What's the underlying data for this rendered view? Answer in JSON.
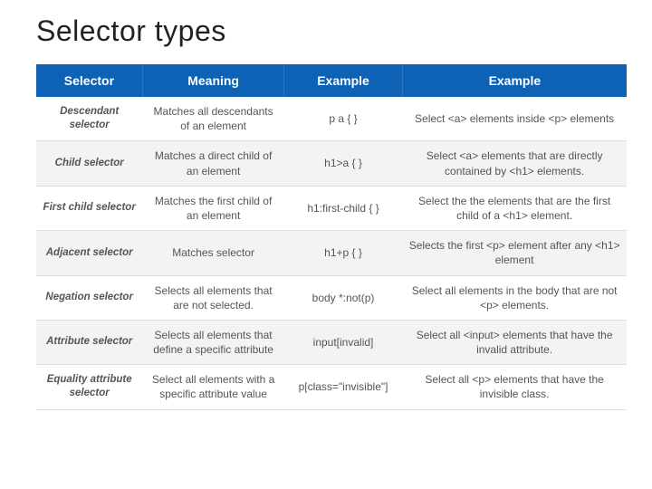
{
  "title": "Selector types",
  "table": {
    "headers": {
      "c0": "Selector",
      "c1": "Meaning",
      "c2": "Example",
      "c3": "Example"
    },
    "rows": [
      {
        "name": "Descendant selector",
        "meaning": "Matches all descendants of an element",
        "code": "p a { }",
        "description": "Select <a> elements inside <p> elements"
      },
      {
        "name": "Child selector",
        "meaning": "Matches a direct child of an element",
        "code": "h1>a { }",
        "description": "Select <a> elements that are directly contained by <h1> elements."
      },
      {
        "name": "First child selector",
        "meaning": "Matches the first child of an element",
        "code": "h1:first-child { }",
        "description": "Select the the elements that are the first child of a <h1> element."
      },
      {
        "name": "Adjacent selector",
        "meaning": "Matches selector",
        "code": "h1+p { }",
        "description": "Selects the first <p> element after any <h1> element"
      },
      {
        "name": "Negation selector",
        "meaning": "Selects all elements that are not selected.",
        "code": "body *:not(p)",
        "description": "Select all elements in the body that are not <p> elements."
      },
      {
        "name": "Attribute selector",
        "meaning": "Selects all elements that define a specific attribute",
        "code": "input[invalid]",
        "description": "Select all <input> elements that have the invalid attribute."
      },
      {
        "name": "Equality attribute selector",
        "meaning": "Select all elements with a specific attribute value",
        "code": "p[class=\"invisible\"]",
        "description": "Select all <p> elements that have the invisible class."
      }
    ]
  }
}
